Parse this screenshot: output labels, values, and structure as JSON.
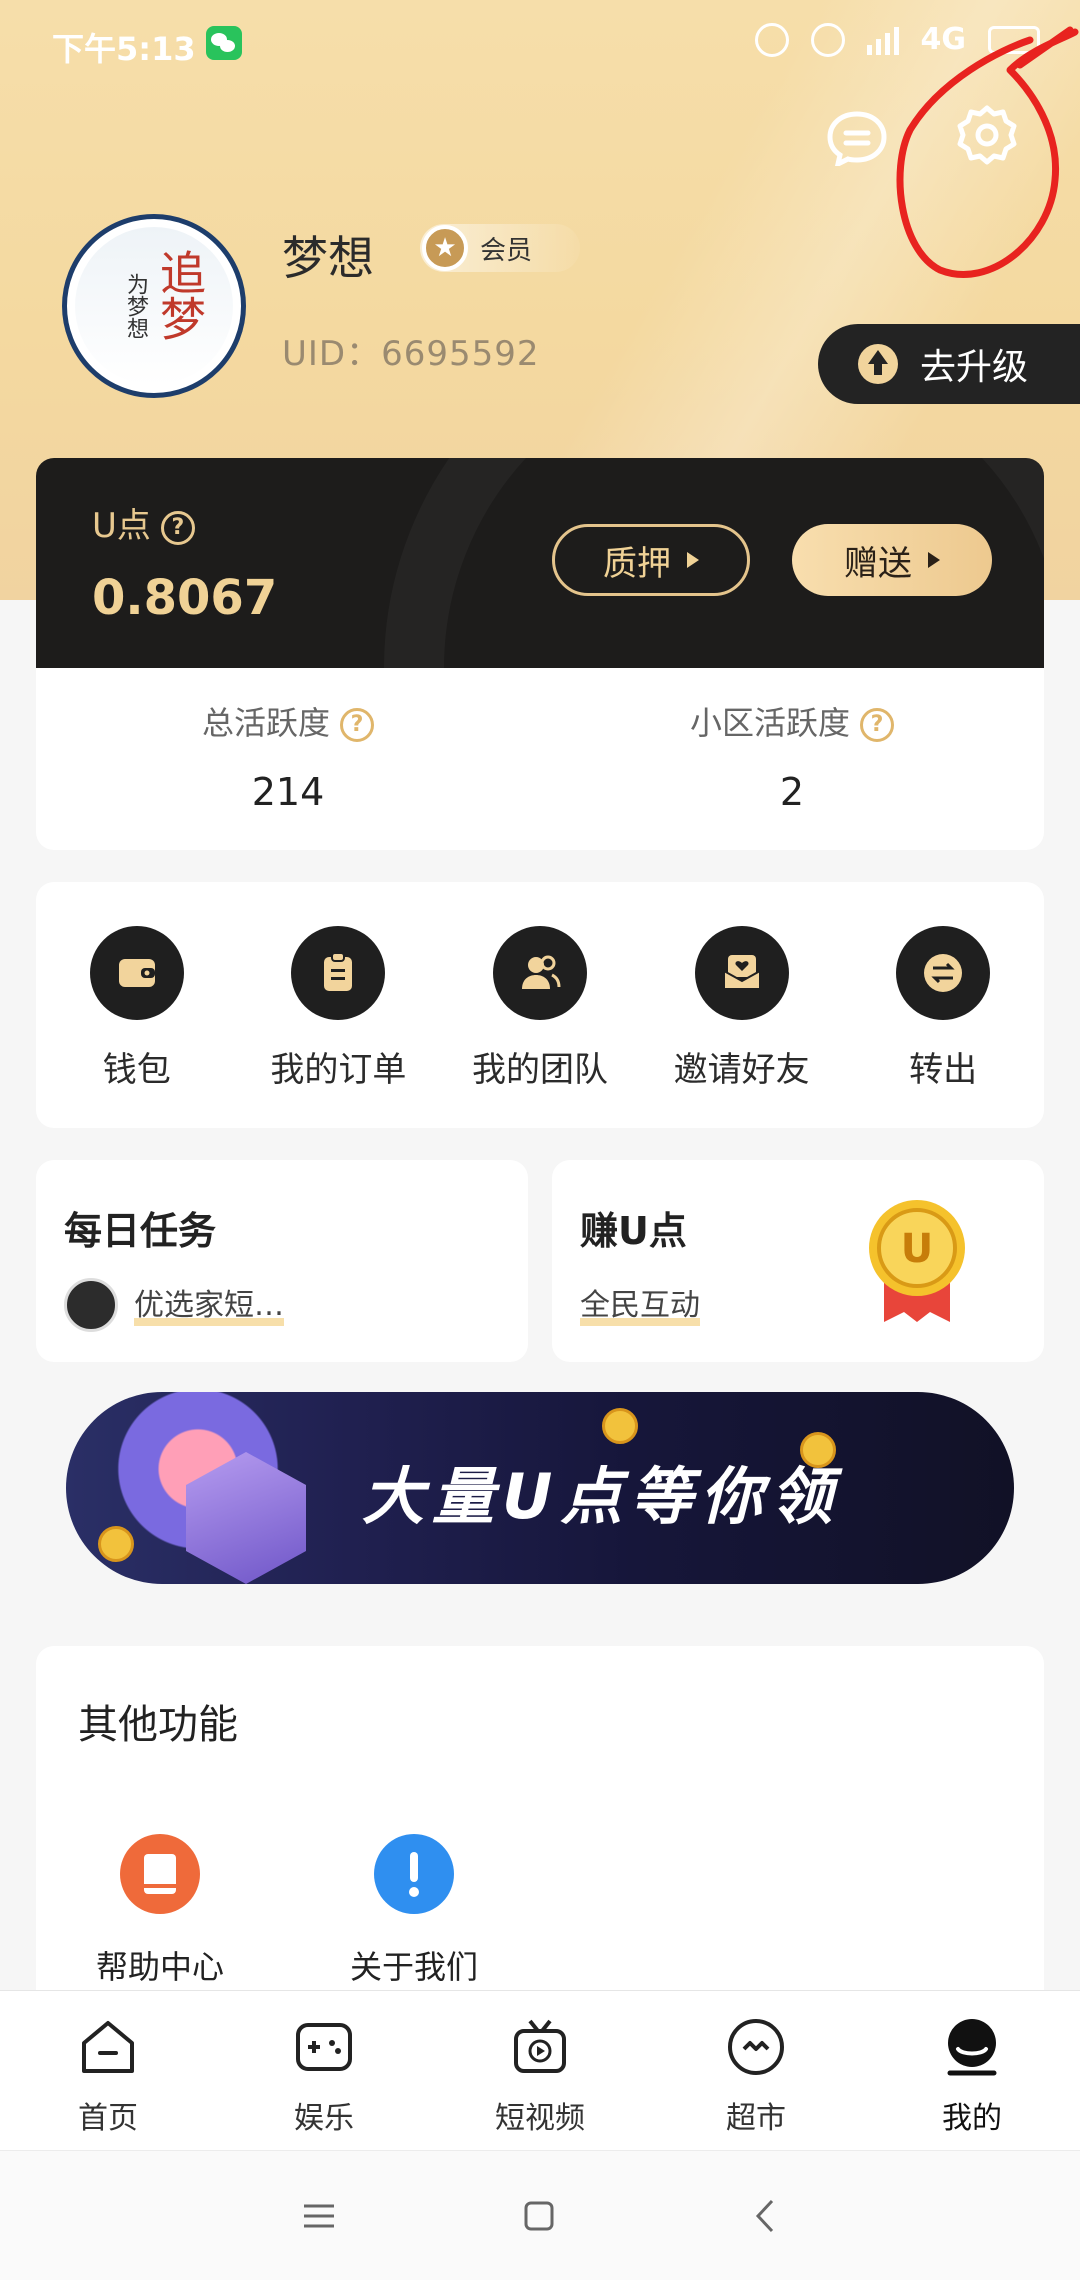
{
  "status_bar": {
    "time": "下午5:13",
    "network": "4G"
  },
  "profile": {
    "name": "梦想",
    "member_label": "会员",
    "uid": "UID：6695592",
    "upgrade_label": "去升级",
    "avatar_text": "追梦",
    "avatar_sub": "为梦想"
  },
  "points": {
    "label": "U点",
    "value": "0.8067",
    "pledge_label": "质押",
    "gift_label": "赠送"
  },
  "activity": {
    "total_label": "总活跃度",
    "total_value": "214",
    "area_label": "小区活跃度",
    "area_value": "2"
  },
  "menu": {
    "items": [
      {
        "label": "钱包",
        "icon": "wallet-icon"
      },
      {
        "label": "我的订单",
        "icon": "order-icon"
      },
      {
        "label": "我的团队",
        "icon": "team-icon"
      },
      {
        "label": "邀请好友",
        "icon": "invite-icon"
      },
      {
        "label": "转出",
        "icon": "transfer-icon"
      }
    ]
  },
  "tasks": {
    "daily_title": "每日任务",
    "daily_sub": "优选家短…",
    "earn_title": "赚U点",
    "earn_sub": "全民互动"
  },
  "banner": {
    "text": "大量U点等你领"
  },
  "other": {
    "title": "其他功能",
    "items": [
      {
        "label": "帮助中心",
        "icon": "book-icon",
        "color": "#ef6a3a"
      },
      {
        "label": "关于我们",
        "icon": "info-icon",
        "color": "#2f8ff0"
      }
    ]
  },
  "nav": {
    "items": [
      {
        "label": "首页",
        "icon": "home-icon"
      },
      {
        "label": "娱乐",
        "icon": "gamepad-icon"
      },
      {
        "label": "短视频",
        "icon": "tv-icon"
      },
      {
        "label": "超市",
        "icon": "market-icon"
      },
      {
        "label": "我的",
        "icon": "profile-icon"
      }
    ]
  },
  "colors": {
    "gold": "#f0d296",
    "dark": "#1d1c1b",
    "accent_annotation": "#e8231f"
  }
}
